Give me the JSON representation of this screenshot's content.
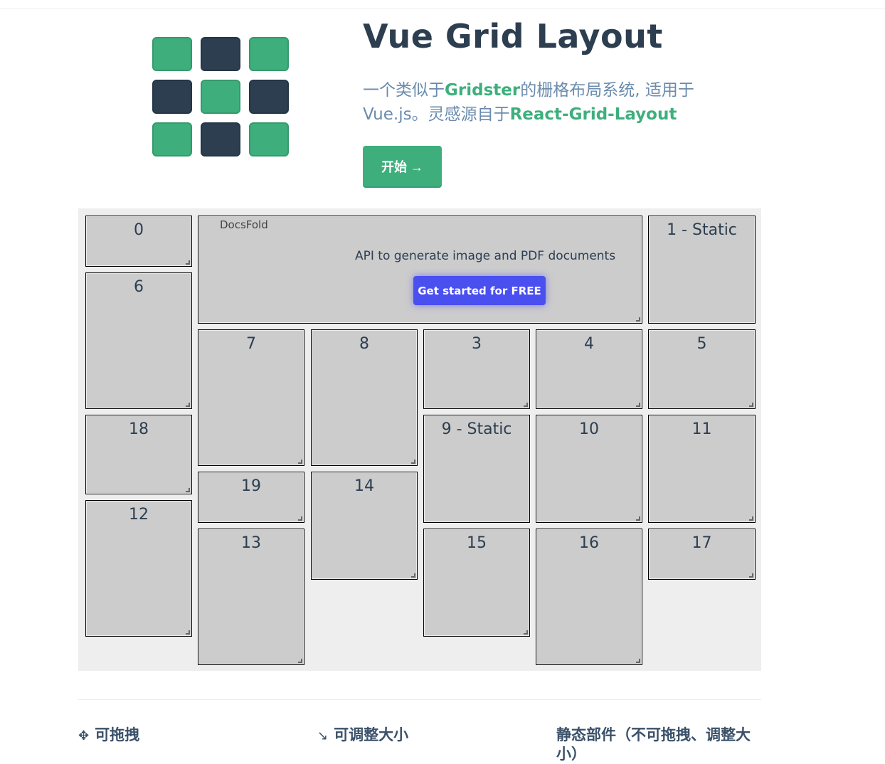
{
  "hero": {
    "title": "Vue Grid Layout",
    "description_parts": {
      "p1": "一个类似于",
      "link1": "Gridster",
      "p2": "的栅格布局系统, 适用于 Vue.js。灵感源自于",
      "link2": "React-Grid-Layout"
    },
    "start_button": "开始 →"
  },
  "colors": {
    "brand_green": "#3eaf7c",
    "dark_navy": "#2c3e50",
    "ad_button": "#4a4ff0"
  },
  "logo": {
    "pattern": [
      "green",
      "dark",
      "green",
      "dark",
      "green",
      "dark",
      "green",
      "dark",
      "green"
    ]
  },
  "grid": {
    "items": [
      {
        "id": "0",
        "label": "0"
      },
      {
        "id": "ad",
        "label": ""
      },
      {
        "id": "1",
        "label": "1 - Static"
      },
      {
        "id": "6",
        "label": "6"
      },
      {
        "id": "7",
        "label": "7"
      },
      {
        "id": "8",
        "label": "8"
      },
      {
        "id": "3",
        "label": "3"
      },
      {
        "id": "4",
        "label": "4"
      },
      {
        "id": "5",
        "label": "5"
      },
      {
        "id": "18",
        "label": "18"
      },
      {
        "id": "9",
        "label": "9 - Static"
      },
      {
        "id": "10",
        "label": "10"
      },
      {
        "id": "11",
        "label": "11"
      },
      {
        "id": "19",
        "label": "19"
      },
      {
        "id": "14",
        "label": "14"
      },
      {
        "id": "12",
        "label": "12"
      },
      {
        "id": "13",
        "label": "13"
      },
      {
        "id": "15",
        "label": "15"
      },
      {
        "id": "16",
        "label": "16"
      },
      {
        "id": "17",
        "label": "17"
      }
    ]
  },
  "ad": {
    "image_alt": "DocsFold",
    "text": "API to generate image and PDF documents",
    "button": "Get started for FREE"
  },
  "features": [
    {
      "icon": "✥",
      "label": "可拖拽"
    },
    {
      "icon": "↘",
      "label": "可调整大小"
    },
    {
      "icon": "",
      "label": "静态部件（不可拖拽、调整大小）"
    }
  ]
}
